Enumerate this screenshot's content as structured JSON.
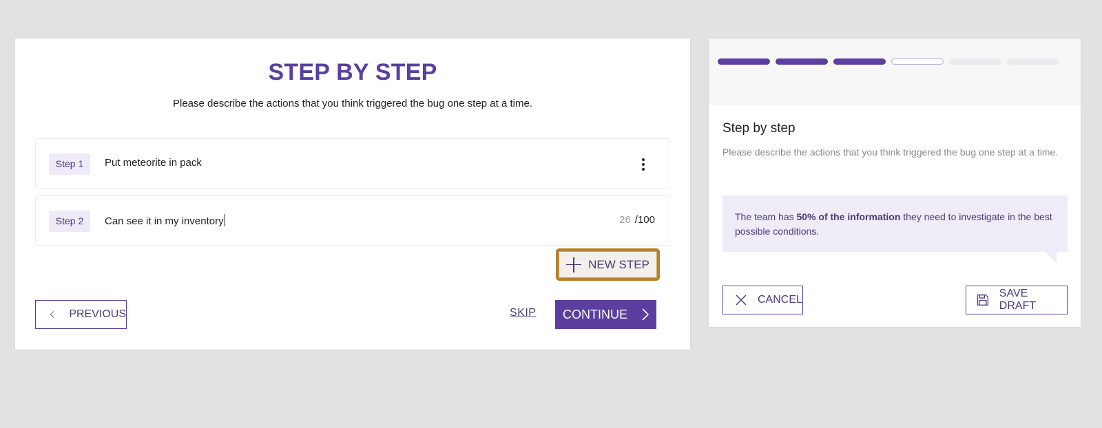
{
  "main": {
    "title": "STEP BY STEP",
    "subtitle": "Please describe the actions that you think triggered the bug one step at a time.",
    "steps": [
      {
        "label": "Step 1",
        "text": "Put meteorite in pack"
      },
      {
        "label": "Step 2",
        "text": "Can see it in my inventory",
        "count": "26",
        "max": "/100"
      }
    ],
    "new_step_label": "NEW STEP",
    "previous_label": "PREVIOUS",
    "skip_label": "SKIP",
    "continue_label": "CONTINUE"
  },
  "side": {
    "progress": {
      "completed": 3,
      "current": 4,
      "total": 6
    },
    "title": "Step by step",
    "description": "Please describe the actions that you think triggered the bug one step at a time.",
    "info_prefix": "The team has ",
    "info_bold": "50% of the information",
    "info_suffix": " they need to investigate in the best possible conditions.",
    "cancel_label": "CANCEL",
    "save_draft_label": "SAVE DRAFT"
  },
  "colors": {
    "accent": "#5b3fa0",
    "focus_ring": "#b5802a",
    "info_background": "#efebf7"
  },
  "icons": [
    "kebab-menu-icon",
    "plus-icon",
    "chevron-left-icon",
    "chevron-right-icon",
    "close-icon",
    "floppy-disk-icon"
  ]
}
